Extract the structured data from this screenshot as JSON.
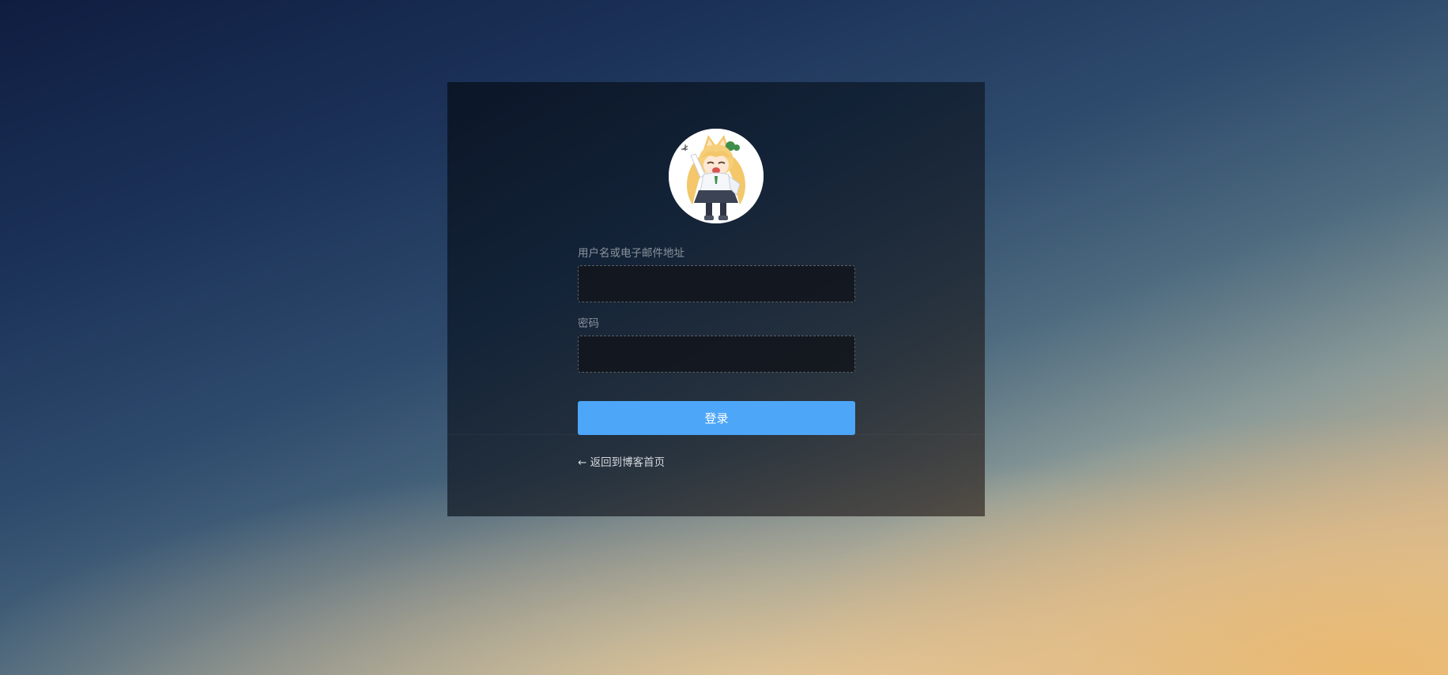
{
  "login_form": {
    "username_label": "用户名或电子邮件地址",
    "username_value": "",
    "password_label": "密码",
    "password_value": "",
    "submit_label": "登录"
  },
  "back_link": {
    "label": "← 返回到博客首页"
  },
  "colors": {
    "accent_button": "#4da6f8",
    "panel_background": "#0f1b2b"
  },
  "avatar": {
    "icon": "anime-girl-avatar"
  }
}
